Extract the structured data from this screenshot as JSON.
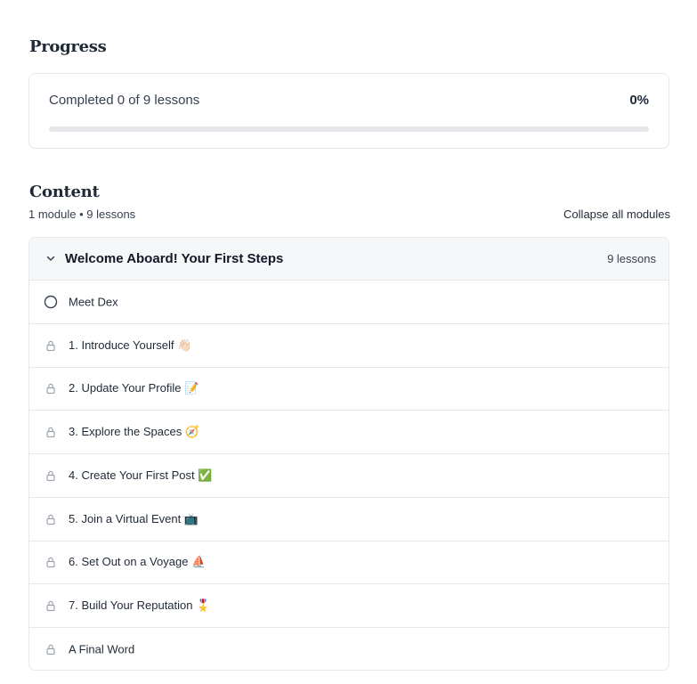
{
  "progress": {
    "title": "Progress",
    "completed_text": "Completed 0 of 9 lessons",
    "percent_text": "0%",
    "percent_value": 0
  },
  "content": {
    "title": "Content",
    "meta": "1 module • 9 lessons",
    "collapse_label": "Collapse all modules"
  },
  "module": {
    "title": "Welcome Aboard! Your First Steps",
    "count": "9 lessons",
    "lessons": [
      {
        "label": "Meet Dex",
        "icon": "circle-icon"
      },
      {
        "label": "1. Introduce Yourself 👋🏻",
        "icon": "lock-icon"
      },
      {
        "label": "2. Update Your Profile 📝",
        "icon": "lock-icon"
      },
      {
        "label": "3. Explore the Spaces 🧭",
        "icon": "lock-icon"
      },
      {
        "label": "4. Create Your First Post ✅",
        "icon": "lock-icon"
      },
      {
        "label": "5. Join a Virtual Event 📺",
        "icon": "lock-icon"
      },
      {
        "label": "6. Set Out on a Voyage ⛵",
        "icon": "lock-icon"
      },
      {
        "label": "7. Build Your Reputation 🎖️",
        "icon": "lock-icon"
      },
      {
        "label": "A Final Word",
        "icon": "lock-icon"
      }
    ]
  },
  "colors": {
    "progress_track": "#e5e7eb",
    "header_bg": "#f6f7f9",
    "border": "#e5e7eb"
  }
}
